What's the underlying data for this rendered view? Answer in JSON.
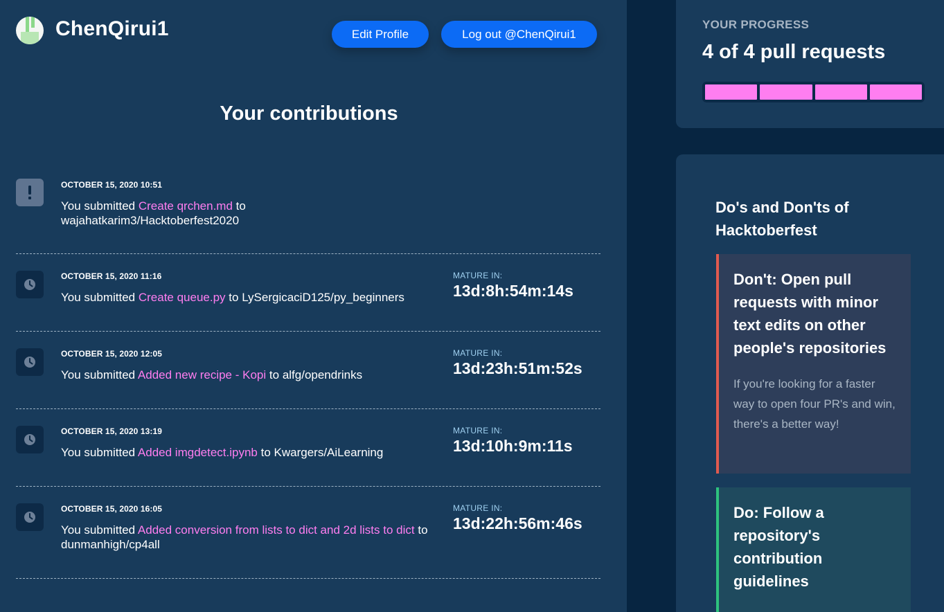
{
  "header": {
    "username": "ChenQirui1",
    "edit_profile_label": "Edit Profile",
    "logout_label": "Log out @ChenQirui1"
  },
  "page_title": "Your contributions",
  "contributions": [
    {
      "status_icon": "exclamation-icon",
      "date": "OCTOBER 15, 2020 10:51",
      "prefix": "You submitted",
      "link": "Create qrchen.md",
      "middle": "to",
      "repo": "wajahatkarim3/Hacktoberfest2020",
      "mature_label": "",
      "mature_value": ""
    },
    {
      "status_icon": "clock-icon",
      "date": "OCTOBER 15, 2020 11:16",
      "prefix": "You submitted",
      "link": "Create queue.py",
      "middle": "to",
      "repo": "LySergicaciD125/py_beginners",
      "mature_label": "MATURE IN:",
      "mature_value": "13d:8h:54m:14s"
    },
    {
      "status_icon": "clock-icon",
      "date": "OCTOBER 15, 2020 12:05",
      "prefix": "You submitted",
      "link": "Added new recipe - Kopi",
      "middle": "to",
      "repo": "alfg/opendrinks",
      "mature_label": "MATURE IN:",
      "mature_value": "13d:23h:51m:52s"
    },
    {
      "status_icon": "clock-icon",
      "date": "OCTOBER 15, 2020 13:19",
      "prefix": "You submitted",
      "link": "Added imgdetect.ipynb",
      "middle": "to",
      "repo": "Kwargers/AiLearning",
      "mature_label": "MATURE IN:",
      "mature_value": "13d:10h:9m:11s"
    },
    {
      "status_icon": "clock-icon",
      "date": "OCTOBER 15, 2020 16:05",
      "prefix": "You submitted",
      "link": "Added conversion from lists to dict and 2d lists to dict",
      "middle": "to",
      "repo": "dunmanhigh/cp4all",
      "mature_label": "MATURE IN:",
      "mature_value": "13d:22h:56m:46s"
    }
  ],
  "progress": {
    "label": "YOUR PROGRESS",
    "count_text": "4 of 4 pull requests",
    "completed": 4,
    "total": 4
  },
  "tips": {
    "title": "Do's and Don'ts of Hacktoberfest",
    "dont": {
      "heading": "Don't: Open pull requests with minor text edits on other people's repositories",
      "body": "If you're looking for a faster way to open four PR's and win, there's a better way!"
    },
    "do": {
      "heading": "Do: Follow a repository's contribution guidelines"
    }
  },
  "colors": {
    "background": "#072541",
    "panel": "#183b5b",
    "accent_button": "#0c6bf5",
    "link_pink": "#ff7ef0",
    "dont_border": "#e05a4f",
    "do_border": "#2ec27e"
  }
}
